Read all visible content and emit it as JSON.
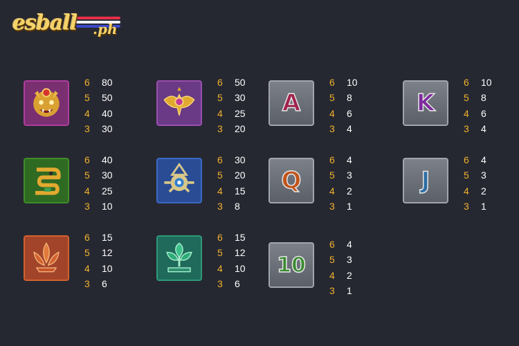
{
  "logo": {
    "text": "esball",
    "suffix": ".ph"
  },
  "symbols": [
    {
      "icon": "jaguar-mask-icon",
      "frame": "#b03d9e",
      "bg": "#7a2f71",
      "pays": [
        {
          "count": "6",
          "value": "80"
        },
        {
          "count": "5",
          "value": "50"
        },
        {
          "count": "4",
          "value": "40"
        },
        {
          "count": "3",
          "value": "30"
        }
      ]
    },
    {
      "icon": "golden-bird-icon",
      "frame": "#9a4fb0",
      "bg": "#6a3a86",
      "pays": [
        {
          "count": "6",
          "value": "50"
        },
        {
          "count": "5",
          "value": "30"
        },
        {
          "count": "4",
          "value": "25"
        },
        {
          "count": "3",
          "value": "20"
        }
      ]
    },
    {
      "icon": "card-a-icon",
      "letter": "A",
      "color": "#a0224d",
      "pays": [
        {
          "count": "6",
          "value": "10"
        },
        {
          "count": "5",
          "value": "8"
        },
        {
          "count": "4",
          "value": "6"
        },
        {
          "count": "3",
          "value": "4"
        }
      ]
    },
    {
      "icon": "card-k-icon",
      "letter": "K",
      "color": "#7d2a9c",
      "pays": [
        {
          "count": "6",
          "value": "10"
        },
        {
          "count": "5",
          "value": "8"
        },
        {
          "count": "4",
          "value": "6"
        },
        {
          "count": "3",
          "value": "4"
        }
      ]
    },
    {
      "icon": "serpent-glyph-icon",
      "frame": "#3f8d2a",
      "bg": "#2f6a23",
      "pays": [
        {
          "count": "6",
          "value": "40"
        },
        {
          "count": "5",
          "value": "30"
        },
        {
          "count": "4",
          "value": "25"
        },
        {
          "count": "3",
          "value": "10"
        }
      ]
    },
    {
      "icon": "sun-eye-totem-icon",
      "frame": "#3a6ac4",
      "bg": "#2a4c94",
      "pays": [
        {
          "count": "6",
          "value": "30"
        },
        {
          "count": "5",
          "value": "20"
        },
        {
          "count": "4",
          "value": "15"
        },
        {
          "count": "3",
          "value": "8"
        }
      ]
    },
    {
      "icon": "card-q-icon",
      "letter": "Q",
      "color": "#c0541c",
      "pays": [
        {
          "count": "6",
          "value": "4"
        },
        {
          "count": "5",
          "value": "3"
        },
        {
          "count": "4",
          "value": "2"
        },
        {
          "count": "3",
          "value": "1"
        }
      ]
    },
    {
      "icon": "card-j-icon",
      "letter": "J",
      "color": "#2e6fa6",
      "pays": [
        {
          "count": "6",
          "value": "4"
        },
        {
          "count": "5",
          "value": "3"
        },
        {
          "count": "4",
          "value": "2"
        },
        {
          "count": "3",
          "value": "1"
        }
      ]
    },
    {
      "icon": "lotus-flower-icon",
      "frame": "#d2622f",
      "bg": "#a2442a",
      "pays": [
        {
          "count": "6",
          "value": "15"
        },
        {
          "count": "5",
          "value": "12"
        },
        {
          "count": "4",
          "value": "10"
        },
        {
          "count": "3",
          "value": "6"
        }
      ]
    },
    {
      "icon": "jade-leaf-icon",
      "frame": "#2f9a7a",
      "bg": "#1f6a5a",
      "pays": [
        {
          "count": "6",
          "value": "15"
        },
        {
          "count": "5",
          "value": "12"
        },
        {
          "count": "4",
          "value": "10"
        },
        {
          "count": "3",
          "value": "6"
        }
      ]
    },
    {
      "icon": "card-10-icon",
      "letter": "10",
      "color": "#3a8a30",
      "pays": [
        {
          "count": "6",
          "value": "4"
        },
        {
          "count": "5",
          "value": "3"
        },
        {
          "count": "4",
          "value": "2"
        },
        {
          "count": "3",
          "value": "1"
        }
      ]
    }
  ]
}
